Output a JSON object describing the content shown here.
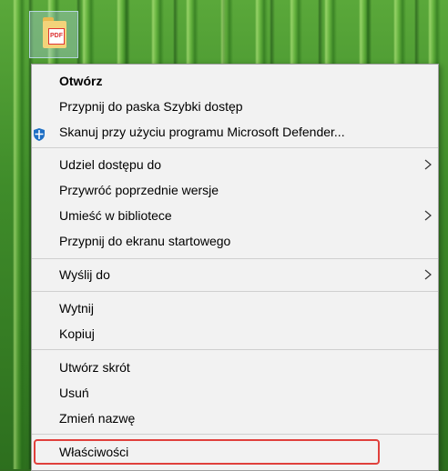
{
  "desktop": {
    "file_icon_badge": "PDF"
  },
  "menu": {
    "items": [
      {
        "label": "Otwórz"
      },
      {
        "label": "Przypnij do paska Szybki dostęp"
      },
      {
        "label": "Skanuj przy użyciu programu Microsoft Defender..."
      },
      {
        "label": "Udziel dostępu do"
      },
      {
        "label": "Przywróć poprzednie wersje"
      },
      {
        "label": "Umieść w bibliotece"
      },
      {
        "label": "Przypnij do ekranu startowego"
      },
      {
        "label": "Wyślij do"
      },
      {
        "label": "Wytnij"
      },
      {
        "label": "Kopiuj"
      },
      {
        "label": "Utwórz skrót"
      },
      {
        "label": "Usuń"
      },
      {
        "label": "Zmień nazwę"
      },
      {
        "label": "Właściwości"
      }
    ]
  },
  "colors": {
    "highlight": "#e0403c",
    "defender_blue": "#1f6fc4"
  }
}
